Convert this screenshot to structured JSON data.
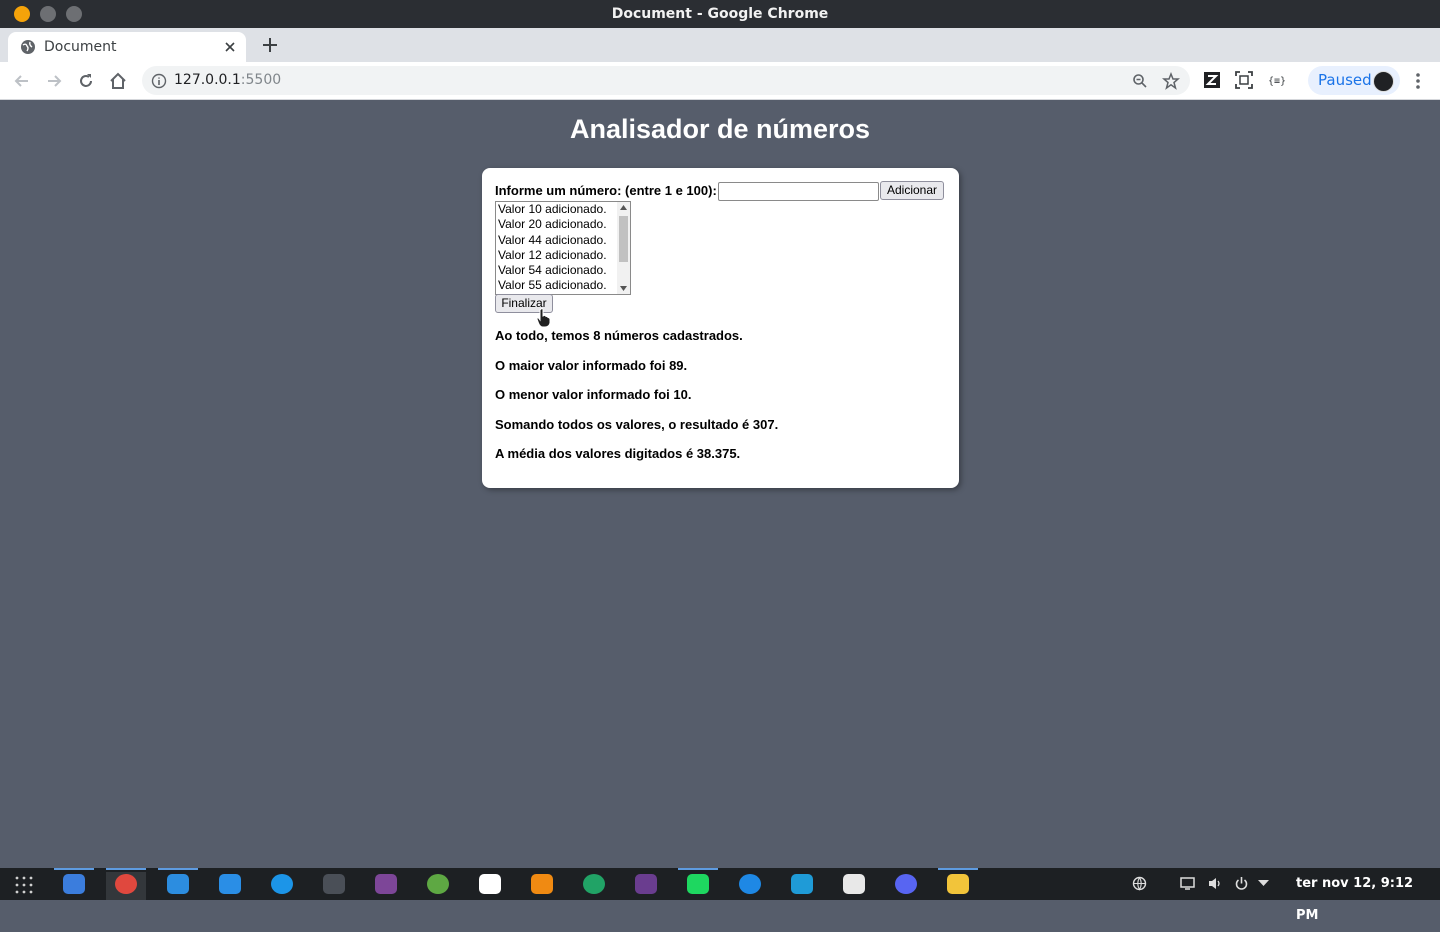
{
  "window": {
    "title": "Document - Google Chrome"
  },
  "browser": {
    "tab_title": "Document",
    "url_host": "127.0.0.1",
    "url_port": ":5500",
    "profile_label": "Paused"
  },
  "page": {
    "heading": "Analisador de números",
    "prompt_label": "Informe um número: (entre 1 e 100):",
    "input_value": "",
    "add_button": "Adicionar",
    "finish_button": "Finalizar",
    "list_items": [
      "Valor 10 adicionado.",
      "Valor 20 adicionado.",
      "Valor 44 adicionado.",
      "Valor 12 adicionado.",
      "Valor 54 adicionado.",
      "Valor 55 adicionado."
    ],
    "results": [
      "Ao todo, temos 8 números cadastrados.",
      "O maior valor informado foi 89.",
      "O menor valor informado foi 10.",
      "Somando todos os valores, o resultado é 307.",
      "A média dos valores digitados é 38.375."
    ]
  },
  "taskbar": {
    "clock": "ter nov 12, 9:12 PM",
    "apps": [
      {
        "icon": "files-icon",
        "color": "#3b7ddd"
      },
      {
        "icon": "chrome-icon",
        "color": "#e0483e"
      },
      {
        "icon": "vscode-icon",
        "color": "#2c8de0"
      },
      {
        "icon": "brackets-icon",
        "color": "#2a8ee6"
      },
      {
        "icon": "settings-mixer-icon",
        "color": "#1c95e8"
      },
      {
        "icon": "terminal-icon",
        "color": "#4a4f57"
      },
      {
        "icon": "tor-browser-icon",
        "color": "#7d4698"
      },
      {
        "icon": "android-studio-icon",
        "color": "#5ea843"
      },
      {
        "icon": "mongodb-compass-icon",
        "color": "#ffffff"
      },
      {
        "icon": "vlc-icon",
        "color": "#f08a12"
      },
      {
        "icon": "cloud-sync-icon",
        "color": "#21a366"
      },
      {
        "icon": "video-editor-icon",
        "color": "#6a3d8f"
      },
      {
        "icon": "spotify-icon",
        "color": "#1ed760"
      },
      {
        "icon": "app-store-icon",
        "color": "#1e88e5"
      },
      {
        "icon": "downloader-icon",
        "color": "#1f9bd7"
      },
      {
        "icon": "postman-icon",
        "color": "#e8e8e8"
      },
      {
        "icon": "discord-icon",
        "color": "#5865f2"
      },
      {
        "icon": "media-player-icon",
        "color": "#f2c43a"
      }
    ]
  }
}
